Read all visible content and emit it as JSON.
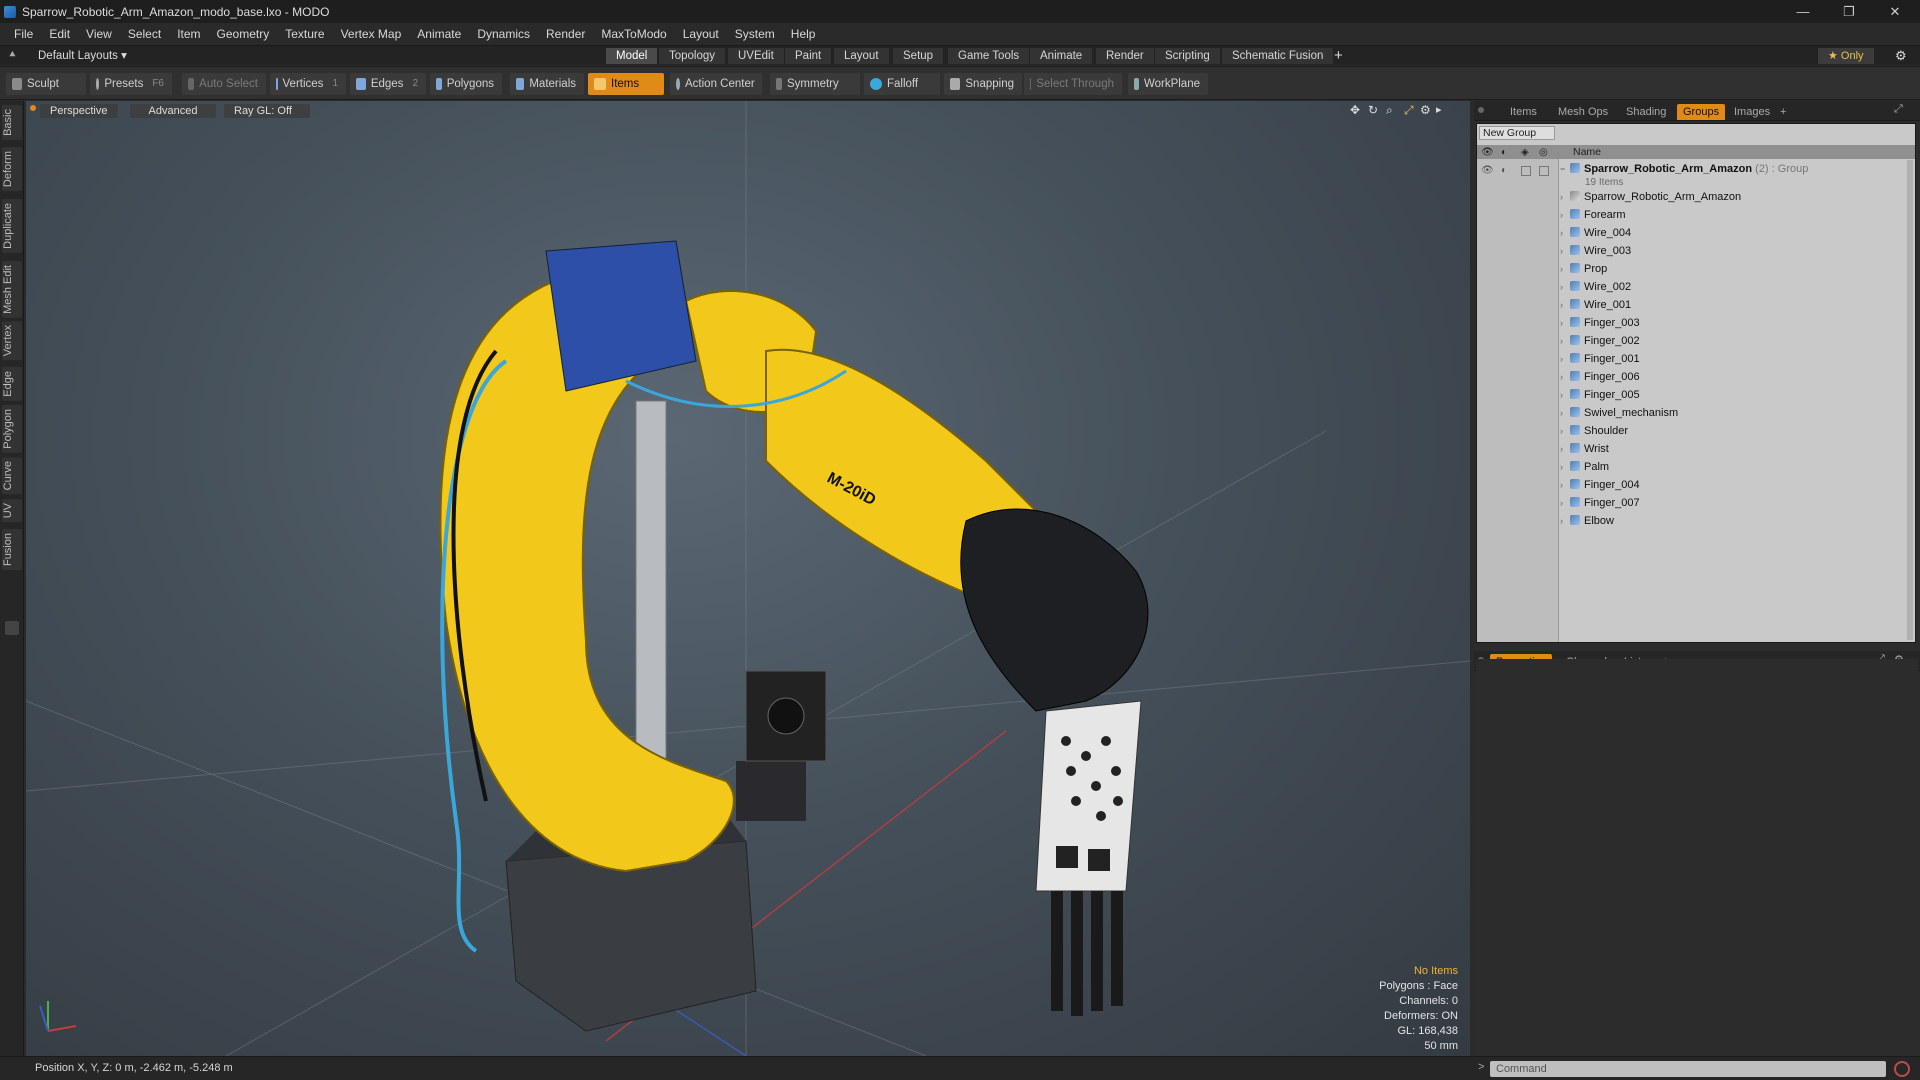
{
  "window": {
    "title": "Sparrow_Robotic_Arm_Amazon_modo_base.lxo - MODO",
    "minimize": "—",
    "restore": "❐",
    "close": "✕"
  },
  "menu": [
    "File",
    "Edit",
    "View",
    "Select",
    "Item",
    "Geometry",
    "Texture",
    "Vertex Map",
    "Animate",
    "Dynamics",
    "Render",
    "MaxToModo",
    "Layout",
    "System",
    "Help"
  ],
  "layoutbar": {
    "layout_label": "Default Layouts ▾",
    "tabs": [
      "Model",
      "Topology",
      "UVEdit",
      "Paint",
      "Layout",
      "Setup",
      "Game Tools",
      "Animate",
      "Render",
      "Scripting",
      "Schematic Fusion"
    ],
    "active_tab": "Model",
    "add": "+",
    "only_label": "★  Only"
  },
  "toolbar": {
    "sculpt": "Sculpt",
    "presets": "Presets",
    "presets_key": "F6",
    "auto_select": "Auto Select",
    "vertices": "Vertices",
    "vertices_count": "1",
    "edges": "Edges",
    "edges_count": "2",
    "polygons": "Polygons",
    "materials": "Materials",
    "items": "Items",
    "action_center": "Action Center",
    "symmetry": "Symmetry",
    "falloff": "Falloff",
    "snapping": "Snapping",
    "select_through": "Select Through",
    "workplane": "WorkPlane"
  },
  "left_tabs": [
    "Basic",
    "Deform",
    "Duplicate",
    "Mesh Edit",
    "Vertex",
    "Edge",
    "Polygon",
    "Curve",
    "UV",
    "Fusion"
  ],
  "viewport": {
    "perspective": "Perspective",
    "advanced": "Advanced",
    "raygl": "Ray GL: Off",
    "model_label": "M-20iD",
    "info": {
      "no_items": "No Items",
      "polygons": "Polygons : Face",
      "channels": "Channels: 0",
      "deformers": "Deformers: ON",
      "gl": "GL: 168,438",
      "scale": "50 mm"
    }
  },
  "status": {
    "position": "Position X, Y, Z:   0 m, -2.462 m, -5.248 m"
  },
  "panel": {
    "tabs": [
      "Items",
      "Mesh Ops",
      "Shading",
      "Groups",
      "Images"
    ],
    "active_tab": "Groups",
    "add": "+",
    "new_group": "New Group",
    "name_col": "Name",
    "group_name": "Sparrow_Robotic_Arm_Amazon",
    "group_suffix": "(2) : Group",
    "group_count": "19 Items",
    "items": [
      "Sparrow_Robotic_Arm_Amazon",
      "Forearm",
      "Wire_004",
      "Wire_003",
      "Prop",
      "Wire_002",
      "Wire_001",
      "Finger_003",
      "Finger_002",
      "Finger_001",
      "Finger_006",
      "Finger_005",
      "Swivel_mechanism",
      "Shoulder",
      "Wrist",
      "Palm",
      "Finger_004",
      "Finger_007",
      "Elbow"
    ]
  },
  "props": {
    "tabs": [
      "Properties",
      "Channels",
      "Lists"
    ],
    "active_tab": "Properties",
    "add": "+"
  },
  "command": {
    "placeholder": "Command"
  },
  "colors": {
    "accent": "#e08a18",
    "arm_yellow": "#f2c81b",
    "background": "#2b2b2b"
  }
}
